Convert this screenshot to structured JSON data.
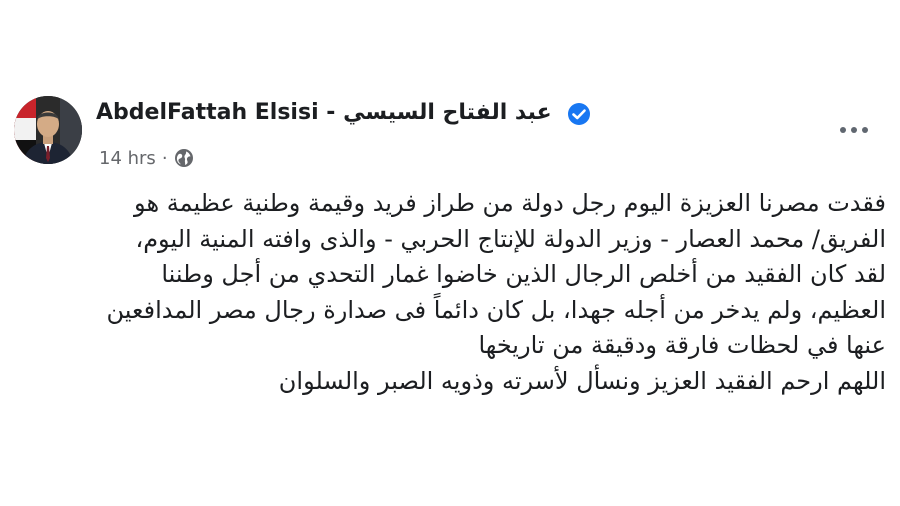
{
  "post": {
    "author": "AbdelFattah Elsisi - عبد الفتاح السيسي",
    "timestamp": "14 hrs",
    "separator": "·",
    "privacy_icon": "globe-icon",
    "verified_icon": "verified-badge-icon",
    "more_icon": "more-options-icon",
    "lines": [
      "فقدت مصرنا العزيزة اليوم رجل دولة من طراز فريد وقيمة وطنية عظيمة هو",
      "الفريق/ محمد العصار - وزير الدولة للإنتاج الحربي - والذى وافته المنية اليوم،",
      "لقد كان الفقيد من أخلص الرجال الذين خاضوا غمار التحدي من أجل وطننا",
      "العظيم، ولم يدخر من أجله جهدا، بل كان دائماً فى صدارة رجال مصر المدافعين",
      "عنها في لحظات فارقة ودقيقة من تاريخها",
      "اللهم ارحم الفقيد العزيز ونسأل لأسرته وذويه الصبر والسلوان"
    ]
  },
  "colors": {
    "text": "#1c1e21",
    "secondary_text": "#65676b",
    "verified_blue": "#1877f2",
    "icon_gray": "#606770"
  }
}
